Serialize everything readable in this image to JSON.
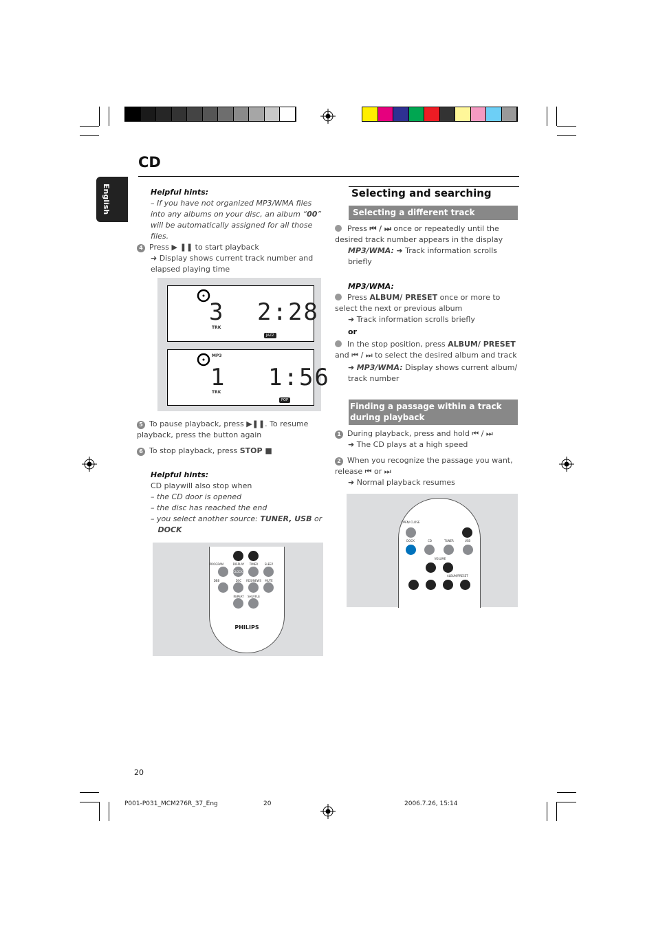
{
  "page": {
    "section": "CD",
    "side_tab": "English",
    "page_number": "20"
  },
  "footer": {
    "file": "P001-P031_MCM276R_37_Eng",
    "page": "20",
    "datetime": "2006.7.26, 15:14"
  },
  "colors": {
    "gray_bar": [
      "#000000",
      "#1a1a1a",
      "#262626",
      "#333333",
      "#444444",
      "#555555",
      "#6e6e6e",
      "#8a8a8a",
      "#a6a6a6",
      "#c8c8c8",
      "#ffffff"
    ],
    "color_bar": [
      "#ffef00",
      "#e6007e",
      "#2e3192",
      "#00a651",
      "#ed1c24",
      "#333333",
      "#fff799",
      "#f49ac1",
      "#6dcff6",
      "#999999"
    ],
    "remote_highlight": "#0072bc",
    "section_bar": "#888888"
  },
  "left": {
    "hint1": {
      "title": "Helpful hints:",
      "text_a": "– If you have not organized MP3/WMA files into any albums on your disc, an album “",
      "bold": "00",
      "text_b": "” will be automatically assigned for all those files."
    },
    "step4": {
      "num": "4",
      "a": "Press ",
      "sym": "▶ ❚❚",
      "b": " to start playback",
      "result": "➜ Display shows current track number and elapsed playing time"
    },
    "display1": {
      "track": "3",
      "time": "2:28",
      "label": "TRK",
      "genre": "JAZZ"
    },
    "display2": {
      "track": "1",
      "time": "1:56",
      "label": "TRK",
      "format": "MP3",
      "genre": "POP"
    },
    "step5": {
      "num": "5",
      "a": "To pause playback, press ",
      "sym": "▶❚❚",
      "b": ". To resume playback, press the button again"
    },
    "step6": {
      "num": "6",
      "a": "To stop playback, press ",
      "bold": "STOP ■"
    },
    "hint2": {
      "title": "Helpful hints:",
      "intro": "CD playwill also stop when",
      "items": [
        "the CD door is opened",
        "the disc has reached the end"
      ],
      "last_a": "you select another source: ",
      "last_b": "TUNER, USB",
      "last_c": " or ",
      "last_d": "DOCK"
    },
    "remote": {
      "labels": [
        "PROGRAM",
        "DISPLAY",
        "TIMER",
        "SLEEP",
        "DBB",
        "DSC",
        "RDS/NEWS",
        "MUTE",
        "REPEAT",
        "SHUFFLE"
      ],
      "clock": "CLOCK",
      "brand": "PHILIPS"
    }
  },
  "right": {
    "title": "Selecting and searching",
    "sec1": {
      "heading": "Selecting a different track",
      "p1_a": "Press ",
      "p1_sym": "⏮ / ⏭",
      "p1_b": " once or repeatedly until the desired track number appears in the display",
      "p1_mp3": "MP3/WMA:",
      "p1_res": " ➜ Track information scrolls briefly",
      "mp3_head": "MP3/WMA:",
      "p2_a": "Press ",
      "p2_bold": "ALBUM/ PRESET",
      "p2_b": " once or more to select the next or previous album",
      "p2_res": "➜ Track information scrolls briefly",
      "or": "or",
      "p3_a": "In the stop position, press ",
      "p3_bold": "ALBUM/ PRESET",
      "p3_b": " and ⏮ / ⏭ to select the desired album and track",
      "p3_mp3": "MP3/WMA:",
      "p3_res": " Display shows current album/ track number"
    },
    "sec2": {
      "heading": "Finding a passage within a track during playback",
      "s1_num": "1",
      "s1": "During playback, press and hold ⏮ / ⏭",
      "s1_res": "➜ The CD plays at a high speed",
      "s2_num": "2",
      "s2": "When you recognize the passage you want, release ⏮ or ⏭",
      "s2_res": "➜ Normal playback resumes"
    },
    "remote": {
      "labels": [
        "OPEN/ CLOSE",
        "DOCK",
        "CD",
        "TUNER",
        "USB",
        "VOLUME",
        "ALBUM/PRESET"
      ]
    }
  }
}
